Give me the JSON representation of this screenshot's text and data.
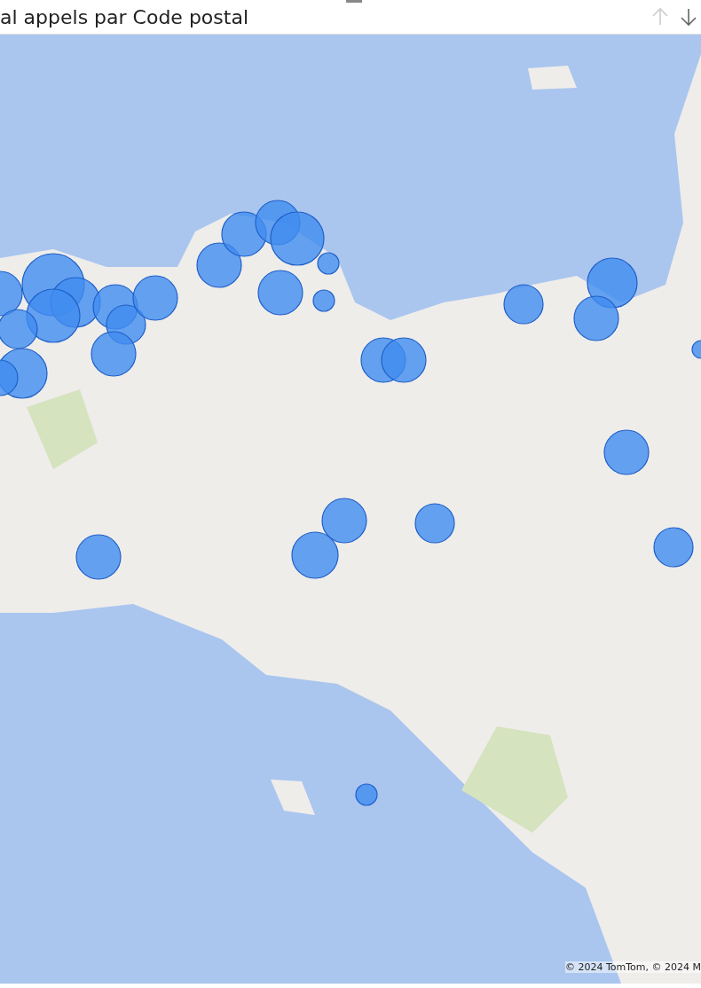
{
  "visual": {
    "title": "al appels par Code postal"
  },
  "header_buttons": [
    {
      "kind": "up",
      "disabled": true
    },
    {
      "kind": "down",
      "disabled": false
    }
  ],
  "map": {
    "attribution": "© 2024 TomTom, © 2024 M"
  }
}
